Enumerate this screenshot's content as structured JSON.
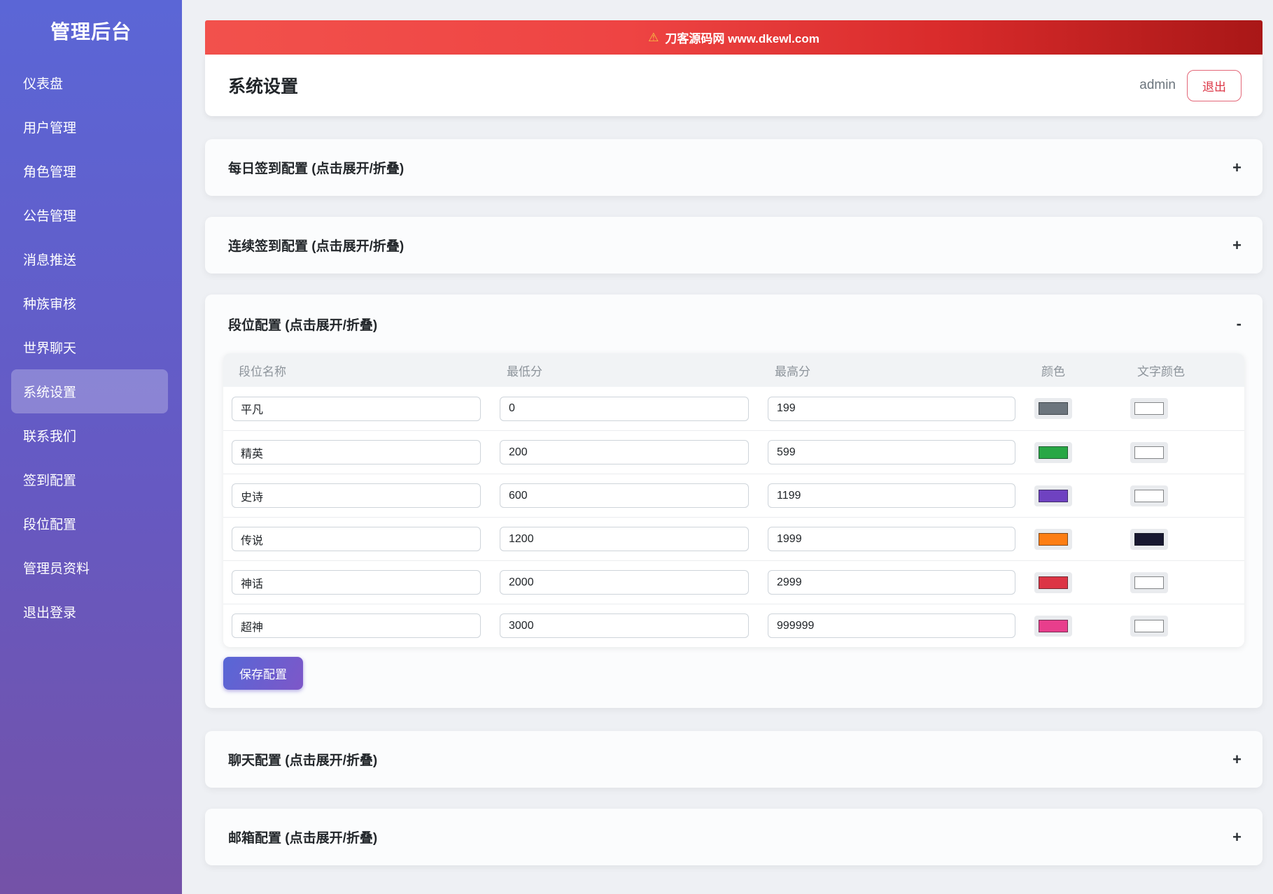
{
  "app": {
    "title": "管理后台"
  },
  "sidebar": {
    "items": [
      {
        "label": "仪表盘",
        "active": false
      },
      {
        "label": "用户管理",
        "active": false
      },
      {
        "label": "角色管理",
        "active": false
      },
      {
        "label": "公告管理",
        "active": false
      },
      {
        "label": "消息推送",
        "active": false
      },
      {
        "label": "种族审核",
        "active": false
      },
      {
        "label": "世界聊天",
        "active": false
      },
      {
        "label": "系统设置",
        "active": true
      },
      {
        "label": "联系我们",
        "active": false
      },
      {
        "label": "签到配置",
        "active": false
      },
      {
        "label": "段位配置",
        "active": false
      },
      {
        "label": "管理员资料",
        "active": false
      },
      {
        "label": "退出登录",
        "active": false
      }
    ]
  },
  "banner": {
    "warning_icon": "⚠",
    "text": "刀客源码网 www.dkewl.com"
  },
  "header": {
    "title": "系统设置",
    "username": "admin",
    "logout_label": "退出"
  },
  "sections": [
    {
      "title": "每日签到配置 (点击展开/折叠)",
      "toggle": "+"
    },
    {
      "title": "连续签到配置 (点击展开/折叠)",
      "toggle": "+"
    },
    {
      "title": "段位配置 (点击展开/折叠)",
      "toggle": "-"
    },
    {
      "title": "聊天配置 (点击展开/折叠)",
      "toggle": "+"
    },
    {
      "title": "邮箱配置 (点击展开/折叠)",
      "toggle": "+"
    }
  ],
  "rank_table": {
    "columns": [
      "段位名称",
      "最低分",
      "最高分",
      "颜色",
      "文字颜色"
    ],
    "rows": [
      {
        "name": "平凡",
        "min": "0",
        "max": "199",
        "color": "#6c757d",
        "text_color": "#ffffff"
      },
      {
        "name": "精英",
        "min": "200",
        "max": "599",
        "color": "#28a745",
        "text_color": "#ffffff"
      },
      {
        "name": "史诗",
        "min": "600",
        "max": "1199",
        "color": "#6f42c1",
        "text_color": "#ffffff"
      },
      {
        "name": "传说",
        "min": "1200",
        "max": "1999",
        "color": "#fd7e14",
        "text_color": "#181830"
      },
      {
        "name": "神话",
        "min": "2000",
        "max": "2999",
        "color": "#dc3545",
        "text_color": "#ffffff"
      },
      {
        "name": "超神",
        "min": "3000",
        "max": "999999",
        "color": "#e83e8c",
        "text_color": "#ffffff"
      }
    ],
    "save_label": "保存配置"
  }
}
